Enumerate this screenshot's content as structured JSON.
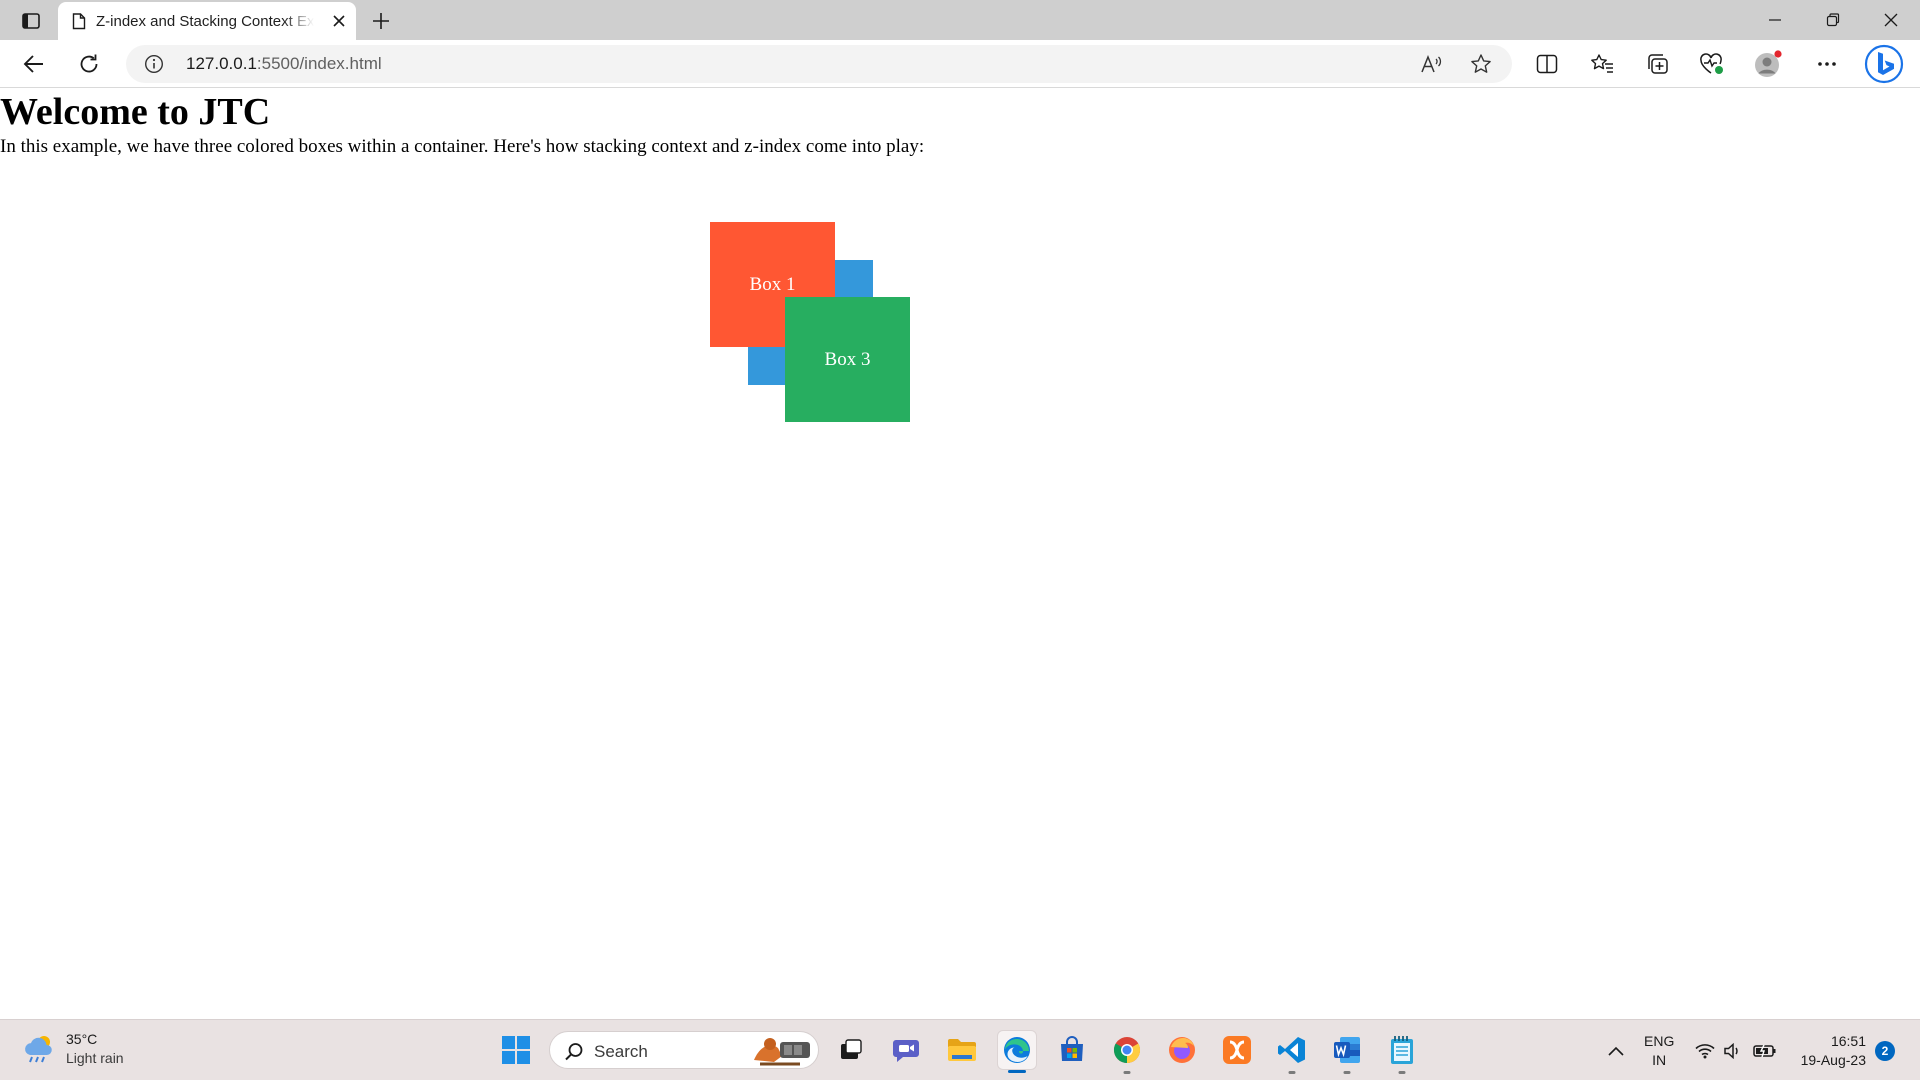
{
  "browser": {
    "tab": {
      "title": "Z-index and Stacking Context Example"
    },
    "address": {
      "url_host": "127.0.0.1",
      "url_path": ":5500/index.html"
    }
  },
  "page": {
    "heading": "Welcome to JTC",
    "intro": "In this example, we have three colored boxes within a container. Here's how stacking context and z-index come into play:",
    "boxes": [
      {
        "label": "Box 1",
        "color": "#ff5733"
      },
      {
        "label": "",
        "color": "#3498db"
      },
      {
        "label": "Box 3",
        "color": "#27ae60"
      }
    ]
  },
  "taskbar": {
    "weather": {
      "temp": "35°C",
      "condition": "Light rain"
    },
    "search": {
      "placeholder": "Search"
    },
    "language": {
      "line1": "ENG",
      "line2": "IN"
    },
    "clock": {
      "time": "16:51",
      "date": "19-Aug-23"
    },
    "notification_count": "2"
  },
  "colors": {
    "tabstrip": "#cfcfcf",
    "accent": "#0067c0"
  }
}
